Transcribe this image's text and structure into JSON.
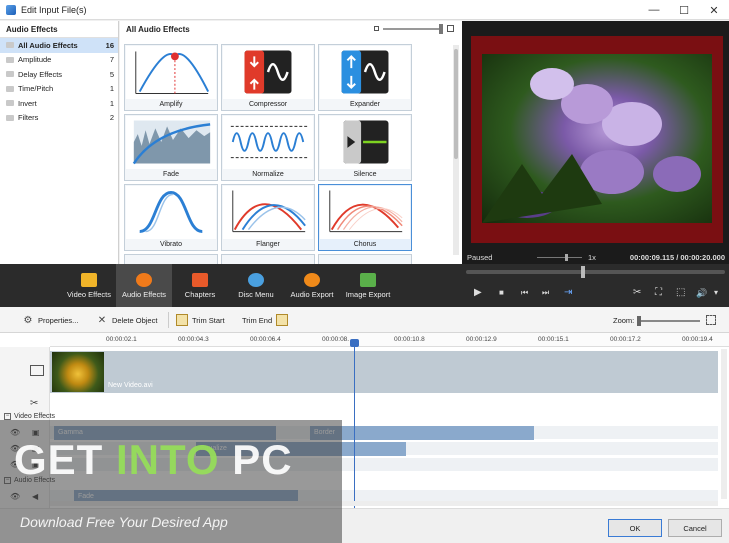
{
  "window": {
    "title": "Edit Input File(s)",
    "minimize": "—",
    "maximize": "☐",
    "close": "✕"
  },
  "categories": {
    "header": "Audio Effects",
    "items": [
      {
        "label": "All Audio Effects",
        "count": "16"
      },
      {
        "label": "Amplitude",
        "count": "7"
      },
      {
        "label": "Delay Effects",
        "count": "5"
      },
      {
        "label": "Time/Pitch",
        "count": "1"
      },
      {
        "label": "Invert",
        "count": "1"
      },
      {
        "label": "Filters",
        "count": "2"
      }
    ]
  },
  "effects": {
    "header": "All Audio Effects",
    "tiles": [
      {
        "name": "Amplify"
      },
      {
        "name": "Compressor"
      },
      {
        "name": "Expander"
      },
      {
        "name": "Fade"
      },
      {
        "name": "Normalize"
      },
      {
        "name": "Silence"
      },
      {
        "name": "Vibrato"
      },
      {
        "name": "Flanger"
      },
      {
        "name": "Chorus"
      }
    ]
  },
  "preview": {
    "status": "Paused",
    "speed": "1x",
    "time": "00:00:09.115 / 00:00:20.000"
  },
  "tabs": [
    {
      "label": "Video Effects",
      "color": "#f0b429"
    },
    {
      "label": "Audio Effects",
      "color": "#f07a1a"
    },
    {
      "label": "Chapters",
      "color": "#e85a2a"
    },
    {
      "label": "Disc Menu",
      "color": "#4aa0e0"
    },
    {
      "label": "Audio Export",
      "color": "#f08a1a"
    },
    {
      "label": "Image Export",
      "color": "#5ab04a"
    }
  ],
  "transport": {
    "play": "▶",
    "stop": "■",
    "prev": "⏮",
    "next": "⏭",
    "frame": "⇥",
    "cut": "✂",
    "snapshot": "⛶",
    "crop": "⬚",
    "volume": "🔊",
    "more": "▾"
  },
  "toolbar": {
    "properties": "Properties...",
    "delete": "Delete Object",
    "trim_start": "Trim Start",
    "trim_end": "Trim End",
    "zoom_label": "Zoom:"
  },
  "ruler": [
    "00:00:02.1",
    "00:00:04.3",
    "00:00:06.4",
    "00:00:08.",
    "00:00:10.8",
    "00:00:12.9",
    "00:00:15.1",
    "00:00:17.2",
    "00:00:19.4"
  ],
  "timeline": {
    "clip_name": "New Video.avi",
    "video_effects_label": "Video Effects",
    "audio_effects_label": "Audio Effects",
    "bars": {
      "gamma": "Gamma",
      "border": "Border",
      "equalize": "Equalize",
      "fade": "Fade"
    }
  },
  "buttons": {
    "ok": "OK",
    "cancel": "Cancel"
  },
  "watermark": {
    "part1": "GET ",
    "part2": "INTO",
    "part3": " PC",
    "tagline": "Download Free Your Desired App"
  }
}
